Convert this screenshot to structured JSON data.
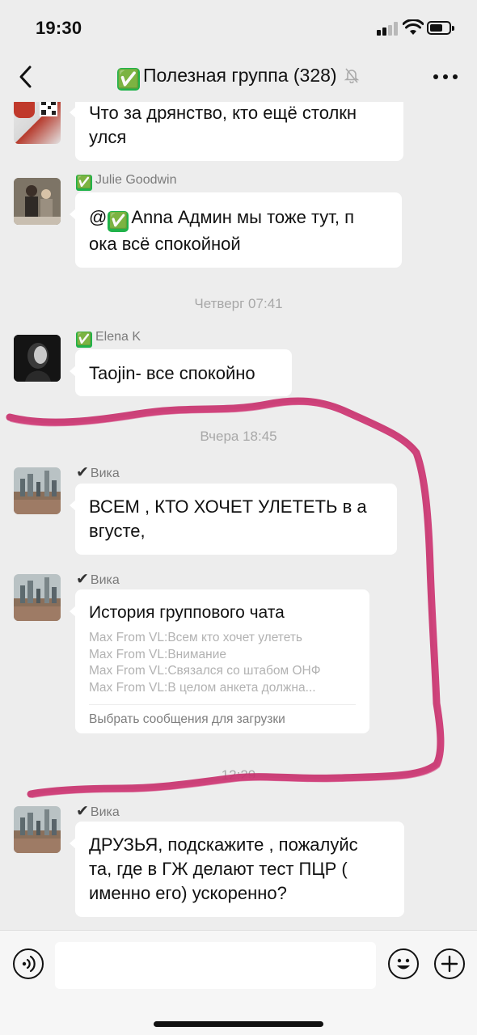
{
  "status_bar": {
    "time": "19:30",
    "icons": [
      "signal-icon",
      "wifi-icon",
      "battery-icon"
    ]
  },
  "nav": {
    "back_icon": "chevron-left-icon",
    "title": "Полезная группа (328)",
    "title_badge": "✅",
    "muted_icon": "bell-slash-icon",
    "more_icon": "more-dots-icon"
  },
  "messages": [
    {
      "sender": "",
      "text_lines": [
        "Что за дрянство, кто ещё столкн",
        "улся"
      ]
    },
    {
      "sender": "Julie Goodwin",
      "verified": "✅",
      "mention": "@",
      "mention_badge": "✅",
      "text_lines": [
        "Anna Админ мы тоже тут, п",
        "ока всё спокойной"
      ]
    },
    {
      "divider": "Четверг 07:41"
    },
    {
      "sender": "Elena K",
      "verified": "✅",
      "text_lines": [
        "Taojin- все спокойно"
      ]
    },
    {
      "divider": "Вчера 18:45"
    },
    {
      "sender": "Вика",
      "tick": "✔",
      "text_lines": [
        "ВСЕМ , КТО ХОЧЕТ УЛЕТЕТЬ в а",
        "вгусте,"
      ]
    },
    {
      "sender": "Вика",
      "tick": "✔",
      "history": {
        "title": "История группового чата",
        "lines": [
          "Max From VL:Всем кто хочет улететь",
          "Max From VL:Внимание",
          "Max From VL:Связался со штабом ОНФ",
          "Max From VL:В целом анкета должна..."
        ],
        "footer": "Выбрать сообщения для загрузки"
      }
    },
    {
      "divider": "12:29"
    },
    {
      "sender": "Вика",
      "tick": "✔",
      "text_lines": [
        "ДРУЗЬЯ, подскажите , пожалуйс",
        "та, где в ГЖ делают тест ПЦР  (",
        "именно его) ускоренно?"
      ]
    }
  ],
  "input_bar": {
    "voice_icon": "voice-icon",
    "input_value": "",
    "emoji_icon": "emoji-icon",
    "plus_icon": "plus-icon"
  },
  "colors": {
    "background": "#ededed",
    "bubble": "#ffffff",
    "verified_green": "#21b24a",
    "scribble": "#c8326e",
    "meta_text": "#a8a8a8"
  }
}
